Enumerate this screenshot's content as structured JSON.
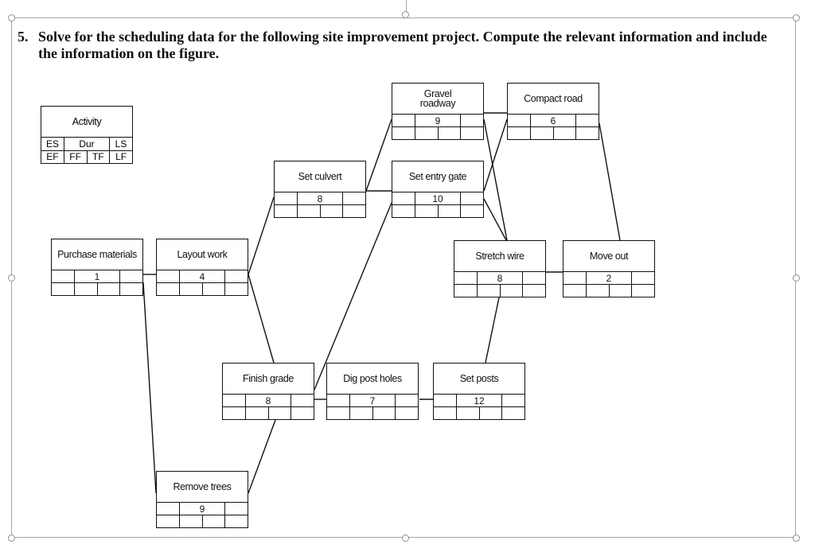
{
  "question": {
    "number": "5.",
    "line1": "Solve for the scheduling data for the following site improvement project. Compute the relevant information and include",
    "line2": "the information on the figure."
  },
  "legend": {
    "title": "Activity",
    "top_row": [
      "ES",
      "Dur",
      "LS"
    ],
    "bottom_row": [
      "EF",
      "FF",
      "TF",
      "LF"
    ]
  },
  "nodes": {
    "purchase": {
      "name": "Purchase materials",
      "duration": "1"
    },
    "layout": {
      "name": "Layout work",
      "duration": "4"
    },
    "remove_trees": {
      "name": "Remove trees",
      "duration": "9"
    },
    "set_culvert": {
      "name": "Set culvert",
      "duration": "8"
    },
    "finish_grade": {
      "name": "Finish grade",
      "duration": "8"
    },
    "dig_post_holes": {
      "name": "Dig post holes",
      "duration": "7"
    },
    "set_posts": {
      "name": "Set posts",
      "duration": "12"
    },
    "gravel_roadway": {
      "name": "Gravel roadway",
      "duration": "9"
    },
    "set_entry_gate": {
      "name": "Set entry gate",
      "duration": "10"
    },
    "compact_road": {
      "name": "Compact road",
      "duration": "6"
    },
    "stretch_wire": {
      "name": "Stretch wire",
      "duration": "8"
    },
    "move_out": {
      "name": "Move out",
      "duration": "2"
    }
  }
}
